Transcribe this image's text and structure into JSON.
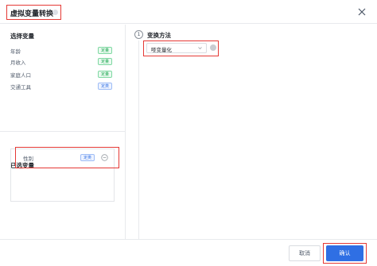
{
  "dialog": {
    "title": "虚拟变量转换",
    "help_icon": "question-circle-icon",
    "close_icon": "close-icon"
  },
  "left_panel": {
    "variables_title": "选择变量",
    "variables": [
      {
        "name": "年龄",
        "tag": "定量",
        "tag_color": "green"
      },
      {
        "name": "月收入",
        "tag": "定量",
        "tag_color": "green"
      },
      {
        "name": "家庭人口",
        "tag": "定量",
        "tag_color": "green"
      },
      {
        "name": "交通工具",
        "tag": "定类",
        "tag_color": "blue"
      }
    ],
    "selected_title": "已选变量",
    "selected": [
      {
        "name": "性别",
        "tag": "定类",
        "tag_color": "blue",
        "remove_icon": "minus-circle-icon"
      }
    ]
  },
  "right_panel": {
    "step_number": "1",
    "step_title": "变换方法",
    "method_value": "哑变量化",
    "dropdown_icon": "chevron-down-icon",
    "info_icon": "info-circle-icon"
  },
  "footer": {
    "cancel_label": "取消",
    "confirm_label": "确认"
  },
  "colors": {
    "primary": "#2f6fe4",
    "highlight": "#e53935",
    "tag_green": "#16a34a",
    "tag_blue": "#2f6fe4"
  }
}
